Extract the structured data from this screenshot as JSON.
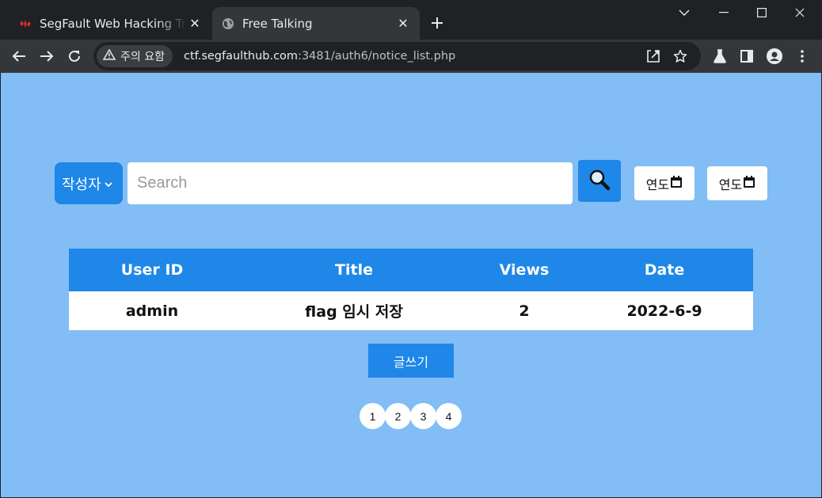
{
  "browser": {
    "tabs": [
      {
        "title": "SegFault Web Hacking Training",
        "active": false,
        "favicon": "segfault-logo-icon"
      },
      {
        "title": "Free Talking",
        "active": true,
        "favicon": "globe-icon"
      }
    ],
    "security_chip": "주의 요함",
    "url_host": "ctf.segfaulthub.com",
    "url_path": ":3481/auth6/notice_list.php"
  },
  "search": {
    "category": "작성자",
    "placeholder": "Search",
    "value": ""
  },
  "date_filters": [
    {
      "label": "연도"
    },
    {
      "label": "연도"
    }
  ],
  "table": {
    "headers": [
      "User ID",
      "Title",
      "Views",
      "Date"
    ],
    "rows": [
      [
        "admin",
        "flag 임시 저장",
        "2",
        "2022-6-9"
      ]
    ]
  },
  "write_button": "글쓰기",
  "pagination": [
    "1",
    "2",
    "3",
    "4"
  ],
  "colors": {
    "page_background": "#82bdf5",
    "accent": "#1e87e8",
    "chrome_dark": "#202124",
    "chrome_toolbar": "#35363a"
  }
}
